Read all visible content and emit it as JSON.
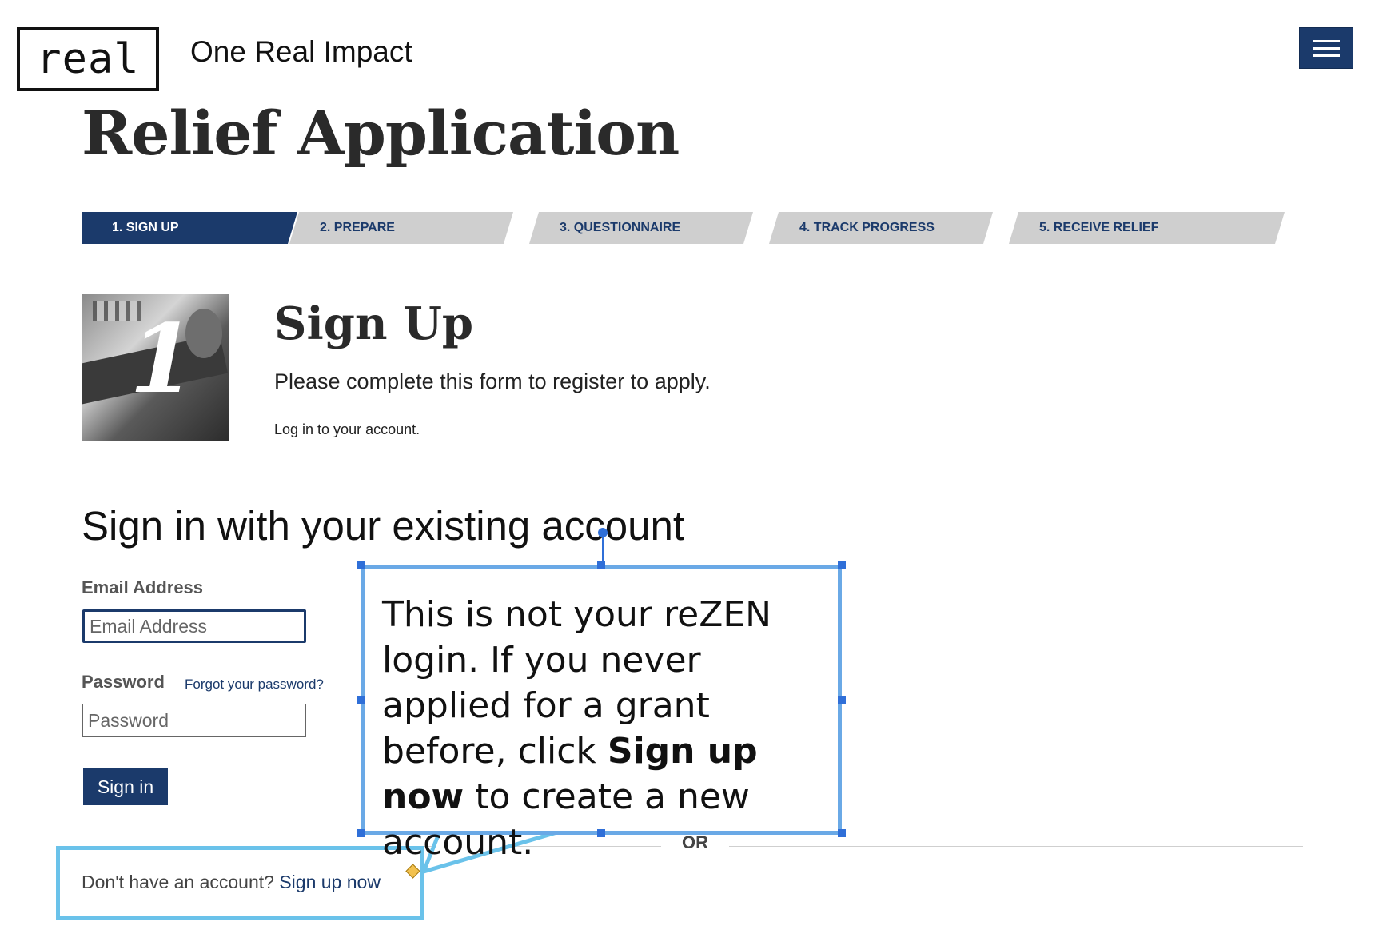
{
  "header": {
    "logo_text": "real",
    "brand_name": "One Real Impact",
    "menu_icon": "hamburger-icon"
  },
  "page": {
    "title": "Relief Application"
  },
  "steps": [
    {
      "label": "1. SIGN UP",
      "active": true
    },
    {
      "label": "2. PREPARE",
      "active": false
    },
    {
      "label": "3. QUESTIONNAIRE",
      "active": false
    },
    {
      "label": "4. TRACK PROGRESS",
      "active": false
    },
    {
      "label": "5. RECEIVE RELIEF",
      "active": false
    }
  ],
  "section": {
    "step_number": "1",
    "title": "Sign Up",
    "description": "Please complete this form to register to apply.",
    "login_text": "Log in to your account."
  },
  "signin": {
    "heading": "Sign in with your existing account",
    "email_label": "Email Address",
    "email_placeholder": "Email Address",
    "password_label": "Password",
    "forgot_link": "Forgot your password?",
    "password_placeholder": "Password",
    "submit_label": "Sign in",
    "or_text": "OR",
    "no_account_text": "Don't have an account?",
    "signup_link": "Sign up now"
  },
  "callout": {
    "text_before": "This is not your reZEN login. If you never applied for a grant before, click",
    "bold_text": "Sign up now",
    "text_after": "to create a new account."
  },
  "colors": {
    "brand_navy": "#1b3a6b",
    "step_inactive": "#cfcfcf",
    "callout_border": "#6aa9e6",
    "highlight_border": "#6ac2ea"
  }
}
